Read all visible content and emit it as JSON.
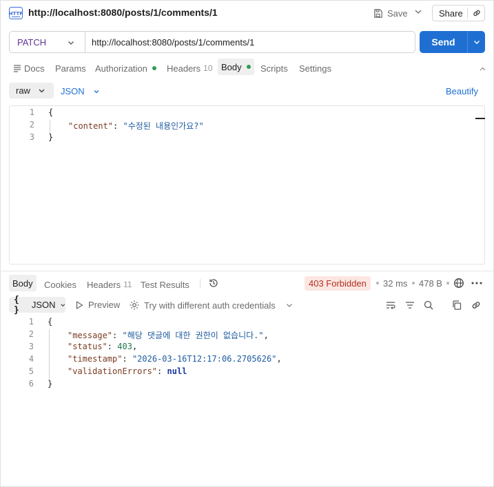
{
  "request": {
    "title": "http://localhost:8080/posts/1/comments/1",
    "method": "PATCH",
    "url": "http://localhost:8080/posts/1/comments/1",
    "save_label": "Save",
    "share_label": "Share",
    "send_label": "Send",
    "tabs": [
      {
        "label": "Docs"
      },
      {
        "label": "Params"
      },
      {
        "label": "Authorization"
      },
      {
        "label": "Headers",
        "count": "10"
      },
      {
        "label": "Body"
      },
      {
        "label": "Scripts"
      },
      {
        "label": "Settings"
      }
    ],
    "body_mode": "raw",
    "body_format": "JSON",
    "beautify_label": "Beautify",
    "body_lines": [
      "1",
      "2",
      "3"
    ],
    "body_code": {
      "open": "{",
      "key": "\"content\"",
      "sep": ": ",
      "value": "\"수정된 내용인가요?\"",
      "close": "}"
    }
  },
  "response": {
    "tabs": [
      {
        "label": "Body"
      },
      {
        "label": "Cookies"
      },
      {
        "label": "Headers",
        "count": "11"
      },
      {
        "label": "Test Results"
      }
    ],
    "status": "403 Forbidden",
    "status_color": "#b3311f",
    "time": "32 ms",
    "size": "478 B",
    "format": "JSON",
    "format_icon": "{ }",
    "preview_label": "Preview",
    "auth_try_label": "Try with different auth credentials",
    "lines": [
      "1",
      "2",
      "3",
      "4",
      "5",
      "6"
    ],
    "code": {
      "open": "{",
      "message_key": "\"message\"",
      "message_value": "\"해당 댓글에 대한 권한이 없습니다.\"",
      "status_key": "\"status\"",
      "status_value": "403",
      "timestamp_key": "\"timestamp\"",
      "timestamp_value": "\"2026-03-16T12:17:06.2705626\"",
      "validation_key": "\"validationErrors\"",
      "validation_value": "null",
      "close": "}"
    }
  },
  "colors": {
    "accent": "#1f6fd3",
    "method": "#623497",
    "active_dot": "#2e9e55"
  },
  "icons": [
    "http-icon",
    "save-icon",
    "link-icon",
    "chevron-down-icon",
    "history-icon",
    "globe-icon",
    "more-icon",
    "play-icon",
    "gear-icon",
    "wrap-icon",
    "filter-icon",
    "search-icon",
    "copy-icon"
  ]
}
